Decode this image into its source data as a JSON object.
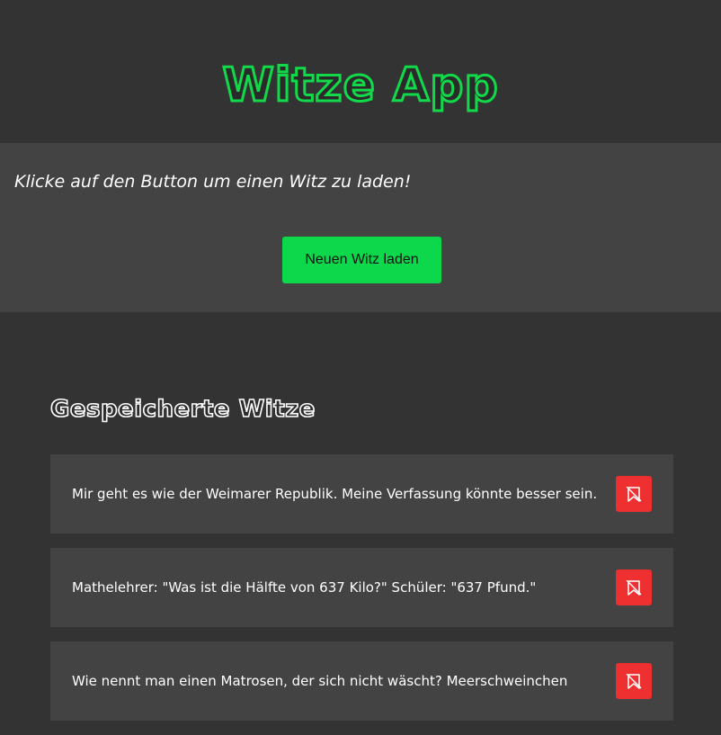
{
  "header": {
    "title": "Witze App"
  },
  "prompt": {
    "text": "Klicke auf den Button um einen Witz zu laden!",
    "button_label": "Neuen Witz laden"
  },
  "saved": {
    "heading": "Gespeicherte Witze",
    "items": [
      {
        "text": "Mir geht es wie der Weimarer Republik. Meine Verfassung könnte besser sein.",
        "action_icon": "bookmark-remove-icon"
      },
      {
        "text": "Mathelehrer: \"Was ist die Hälfte von 637 Kilo?\" Schüler: \"637 Pfund.\"",
        "action_icon": "bookmark-remove-icon"
      },
      {
        "text": "Wie nennt man einen Matrosen, der sich nicht wäscht? Meerschweinchen",
        "action_icon": "bookmark-remove-icon"
      }
    ]
  },
  "colors": {
    "background": "#333333",
    "panel": "#434343",
    "accent_green": "#0dd84c",
    "delete_red": "#ee3030"
  }
}
